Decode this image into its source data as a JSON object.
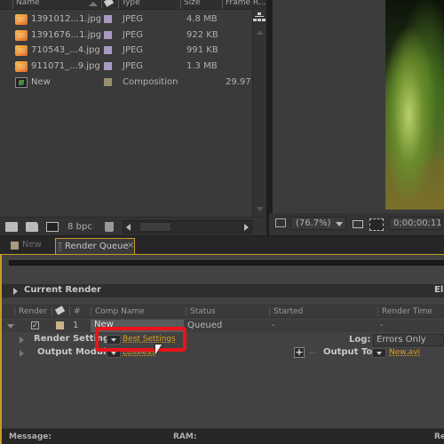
{
  "project": {
    "columns": {
      "name": "Name",
      "type": "Type",
      "size": "Size",
      "frame_rate": "Frame R..."
    },
    "items": [
      {
        "name": "1391012...1.jpg",
        "type": "JPEG",
        "size": "4.8 MB",
        "frame_rate": "",
        "label_color": "#a79bc3",
        "kind": "image"
      },
      {
        "name": "1391676...1.jpg",
        "type": "JPEG",
        "size": "922 KB",
        "frame_rate": "",
        "label_color": "#a79bc3",
        "kind": "image"
      },
      {
        "name": "710543_...4.jpg",
        "type": "JPEG",
        "size": "991 KB",
        "frame_rate": "",
        "label_color": "#a79bc3",
        "kind": "image"
      },
      {
        "name": "911071_...9.jpg",
        "type": "JPEG",
        "size": "1.3 MB",
        "frame_rate": "",
        "label_color": "#a79bc3",
        "kind": "image"
      },
      {
        "name": "New",
        "type": "Composition",
        "size": "",
        "frame_rate": "29.97",
        "label_color": "#9a8f6e",
        "kind": "composition"
      }
    ],
    "footer": {
      "bpc": "8 bpc"
    }
  },
  "viewer": {
    "zoom": "(76.7%)",
    "timecode": "0;00;00;11"
  },
  "tabs": [
    {
      "label": "New",
      "active": false
    },
    {
      "label": "Render Queue",
      "active": true,
      "close": "×"
    }
  ],
  "render_queue": {
    "current_render": "Current Render",
    "elapsed_label": "El",
    "columns": {
      "render": "Render",
      "num": "#",
      "comp_name": "Comp Name",
      "status": "Status",
      "started": "Started",
      "render_time": "Render Time"
    },
    "items": [
      {
        "num": "1",
        "comp_name": "New",
        "status": "Queued",
        "started": "-",
        "render_time": "-",
        "checked": true,
        "label_color": "#c8b38a"
      }
    ],
    "render_settings_label": "Render Settings:",
    "render_settings_value": "Best Settings",
    "output_module_label": "Output Module:",
    "output_module_value": "Lossless",
    "log_label": "Log:",
    "log_value": "Errors Only",
    "output_to_label": "Output To:",
    "output_to_value": "New.avi",
    "add": "+",
    "remove": "−"
  },
  "status_bar": {
    "message": "Message:",
    "ram": "RAM:",
    "renders_started": "Re"
  },
  "colors": {
    "accent": "#c79a2a",
    "link": "#d8a024",
    "highlight": "#e8141a"
  }
}
